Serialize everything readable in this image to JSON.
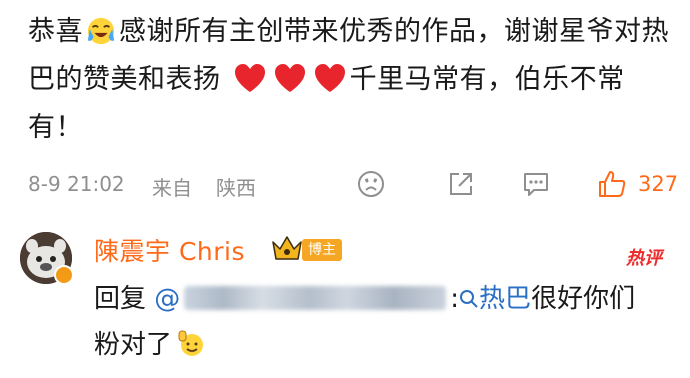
{
  "post": {
    "text_part1": "恭喜",
    "text_part2": "感谢所有主创带来优秀的作品，谢谢星爷对热巴的赞美和表扬",
    "text_part3": "千里马常有，伯乐不常有！",
    "emoji_face": "crying-laughing-emoji",
    "heart_icon": "red-heart-icon",
    "heart_count": 3
  },
  "meta": {
    "time": "8-9 21:02",
    "source_prefix": "来自",
    "location": "陕西",
    "like_count": "327",
    "icons": [
      "sad-face-icon",
      "share-icon",
      "comment-icon",
      "like-icon"
    ]
  },
  "reply": {
    "username": "陳震宇 Chris",
    "badge": "博主",
    "hot_label": "热评",
    "reply_prefix": "回复",
    "mention_at": "@",
    "mention_colon": ":",
    "topic_name": "热巴",
    "text_after_topic": "很好你们粉对了",
    "end_emoji": "waving-hand-emoji"
  },
  "colors": {
    "accent_orange": "#ff6a1a",
    "link_blue": "#2b6fc4",
    "heart_red": "#e8242c",
    "meta_gray": "#8f8f8f",
    "badge_gold": "#f5a623"
  }
}
